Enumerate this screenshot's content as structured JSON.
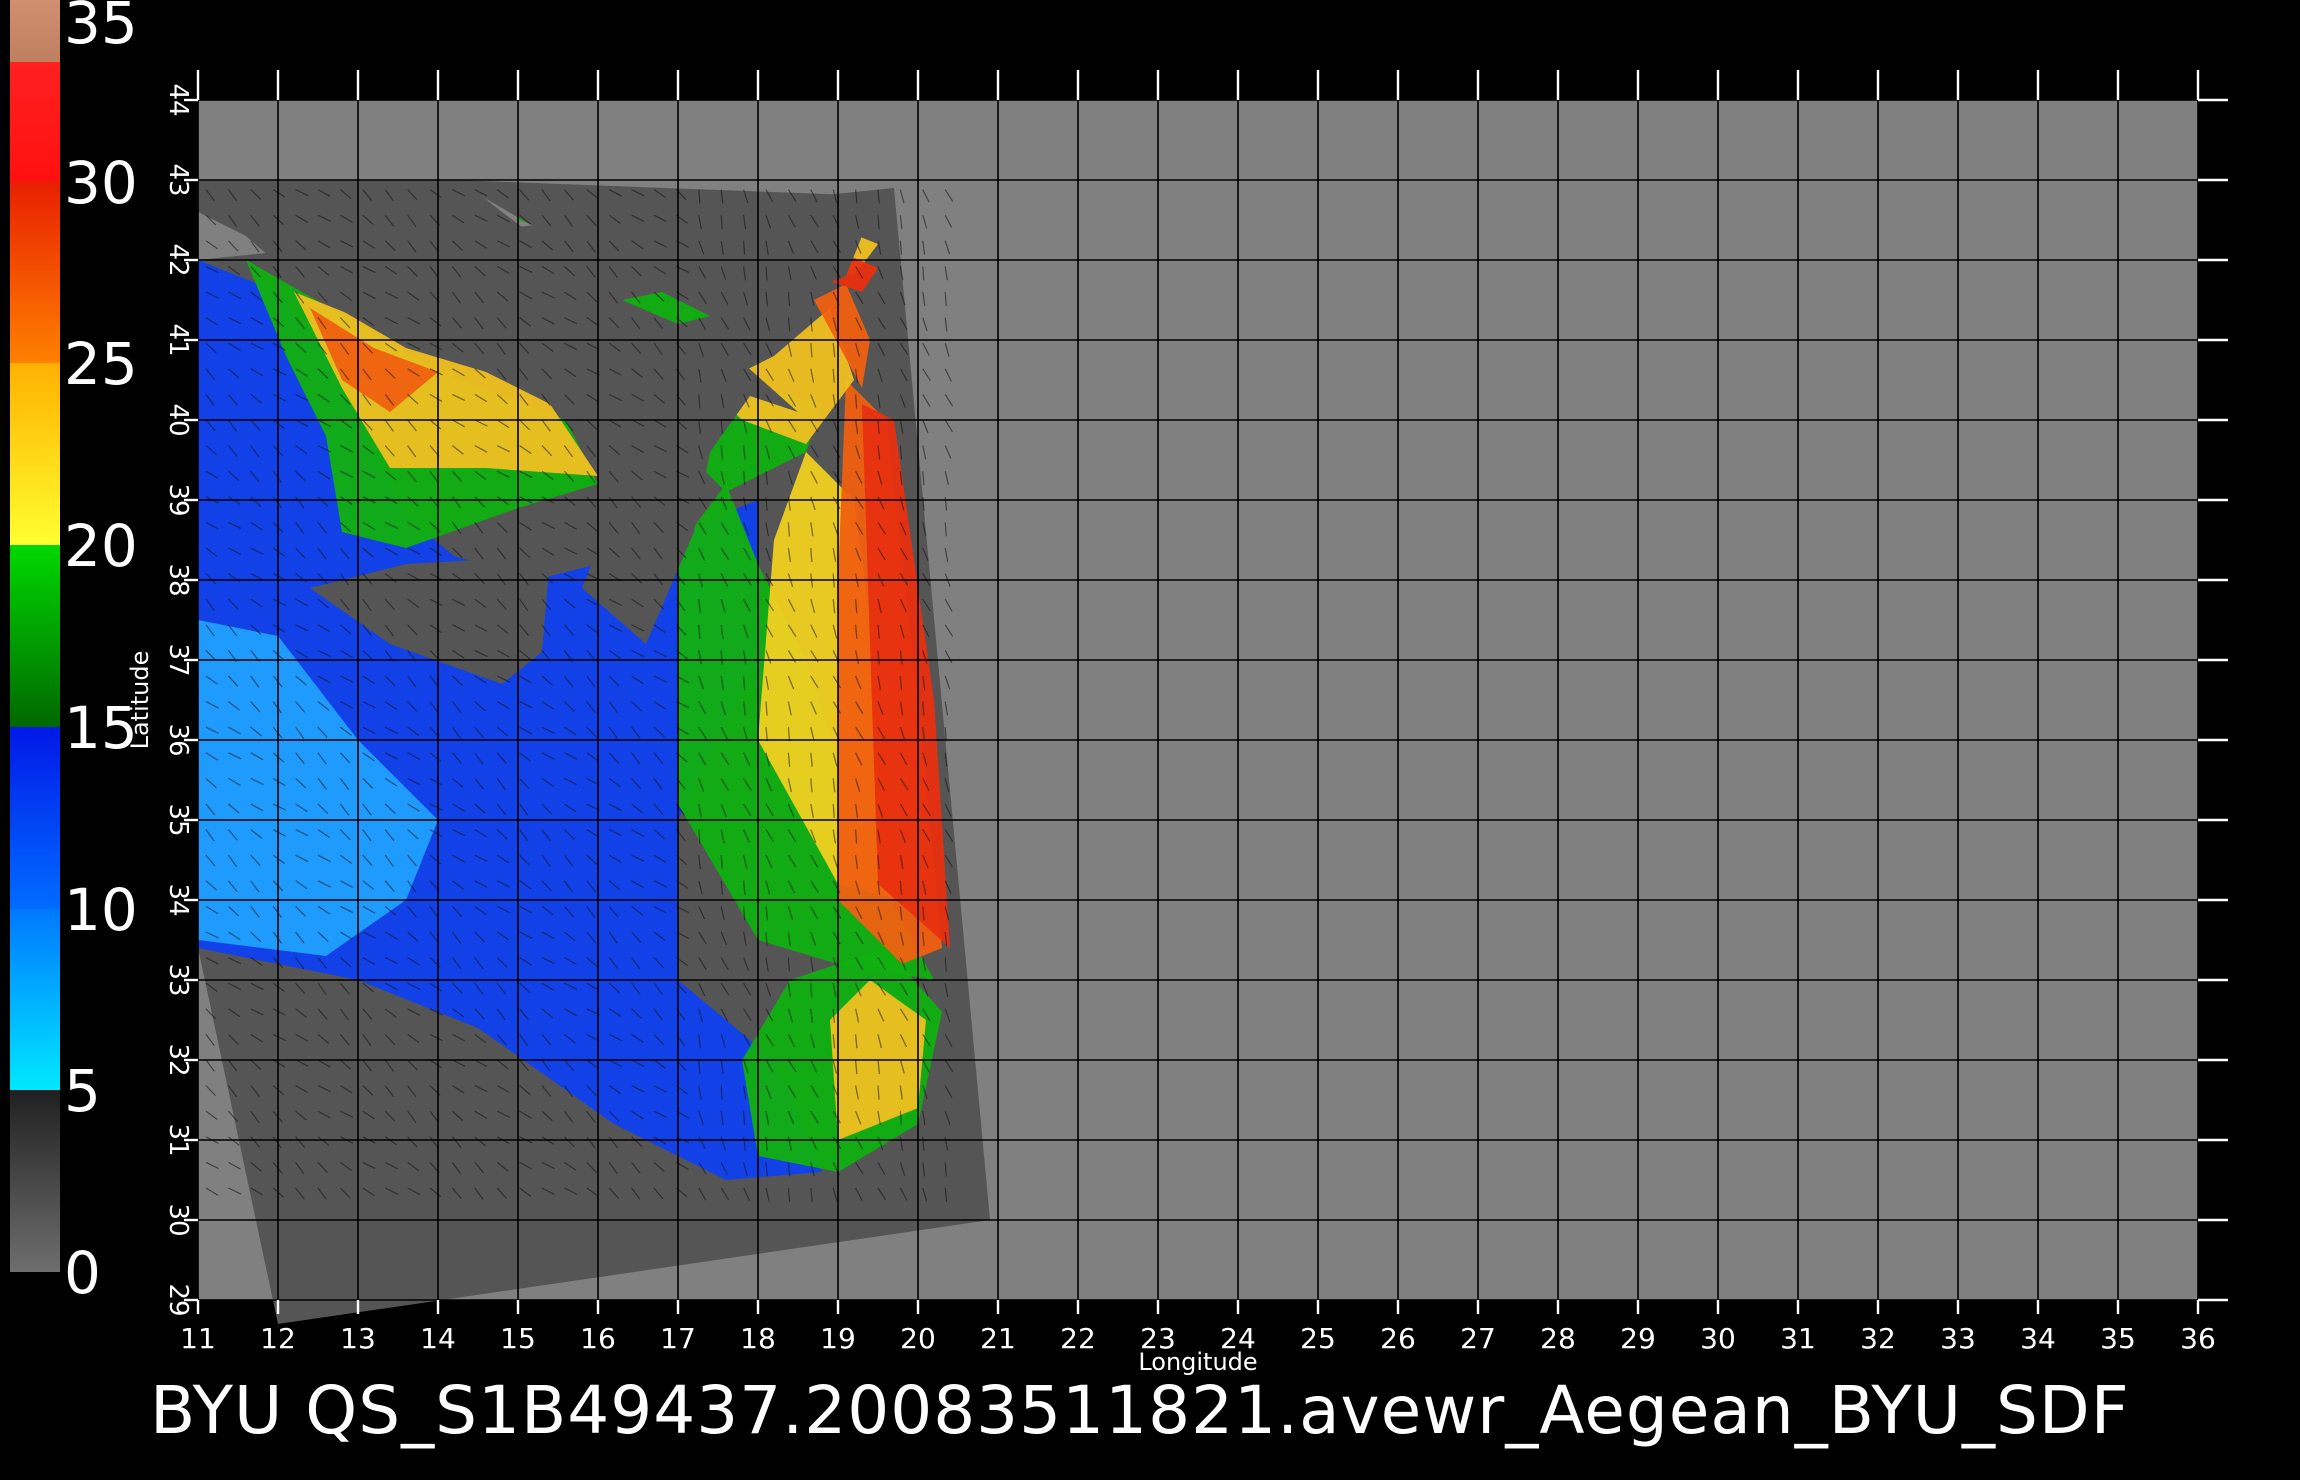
{
  "map": {
    "colorbar": {
      "labels": [
        "0",
        "5",
        "10",
        "15",
        "20",
        "25",
        "30",
        "35"
      ],
      "range": [
        0,
        35
      ],
      "segments": [
        {
          "from": 0,
          "to": 5,
          "colors": [
            "#6e6e6e",
            "#202020"
          ]
        },
        {
          "from": 5,
          "to": 10,
          "colors": [
            "#00e8ff",
            "#0078ff"
          ]
        },
        {
          "from": 10,
          "to": 15,
          "colors": [
            "#006cff",
            "#0018e8"
          ]
        },
        {
          "from": 15,
          "to": 20,
          "colors": [
            "#006800",
            "#00d800"
          ]
        },
        {
          "from": 20,
          "to": 25,
          "colors": [
            "#ffff30",
            "#ffb000"
          ]
        },
        {
          "from": 25,
          "to": 30,
          "colors": [
            "#ff8000",
            "#e82000"
          ]
        },
        {
          "from": 30,
          "to": 33.3,
          "colors": [
            "#ff1010",
            "#ff2020"
          ]
        },
        {
          "from": 33.3,
          "to": 35,
          "colors": [
            "#c08060",
            "#d09070"
          ]
        }
      ]
    },
    "longitude_ticks": [
      "11",
      "12",
      "13",
      "14",
      "15",
      "16",
      "17",
      "18",
      "19",
      "20",
      "21",
      "22",
      "23",
      "24",
      "25",
      "26",
      "27",
      "28",
      "29",
      "30",
      "31",
      "32",
      "33",
      "34",
      "35",
      "36"
    ],
    "latitude_ticks": [
      "29",
      "30",
      "31",
      "32",
      "33",
      "34",
      "35",
      "36",
      "37",
      "38",
      "39",
      "40",
      "41",
      "42",
      "43",
      "44"
    ],
    "x_label": "Longitude",
    "y_label": "Latitude",
    "caption": "BYU QS_S1B49437.20083511821.avewr_Aegean_BYU_SDF",
    "colors": {
      "background": "#000000",
      "no_data": "#808080",
      "swath_land": "#555555",
      "grid": "#000000"
    }
  }
}
